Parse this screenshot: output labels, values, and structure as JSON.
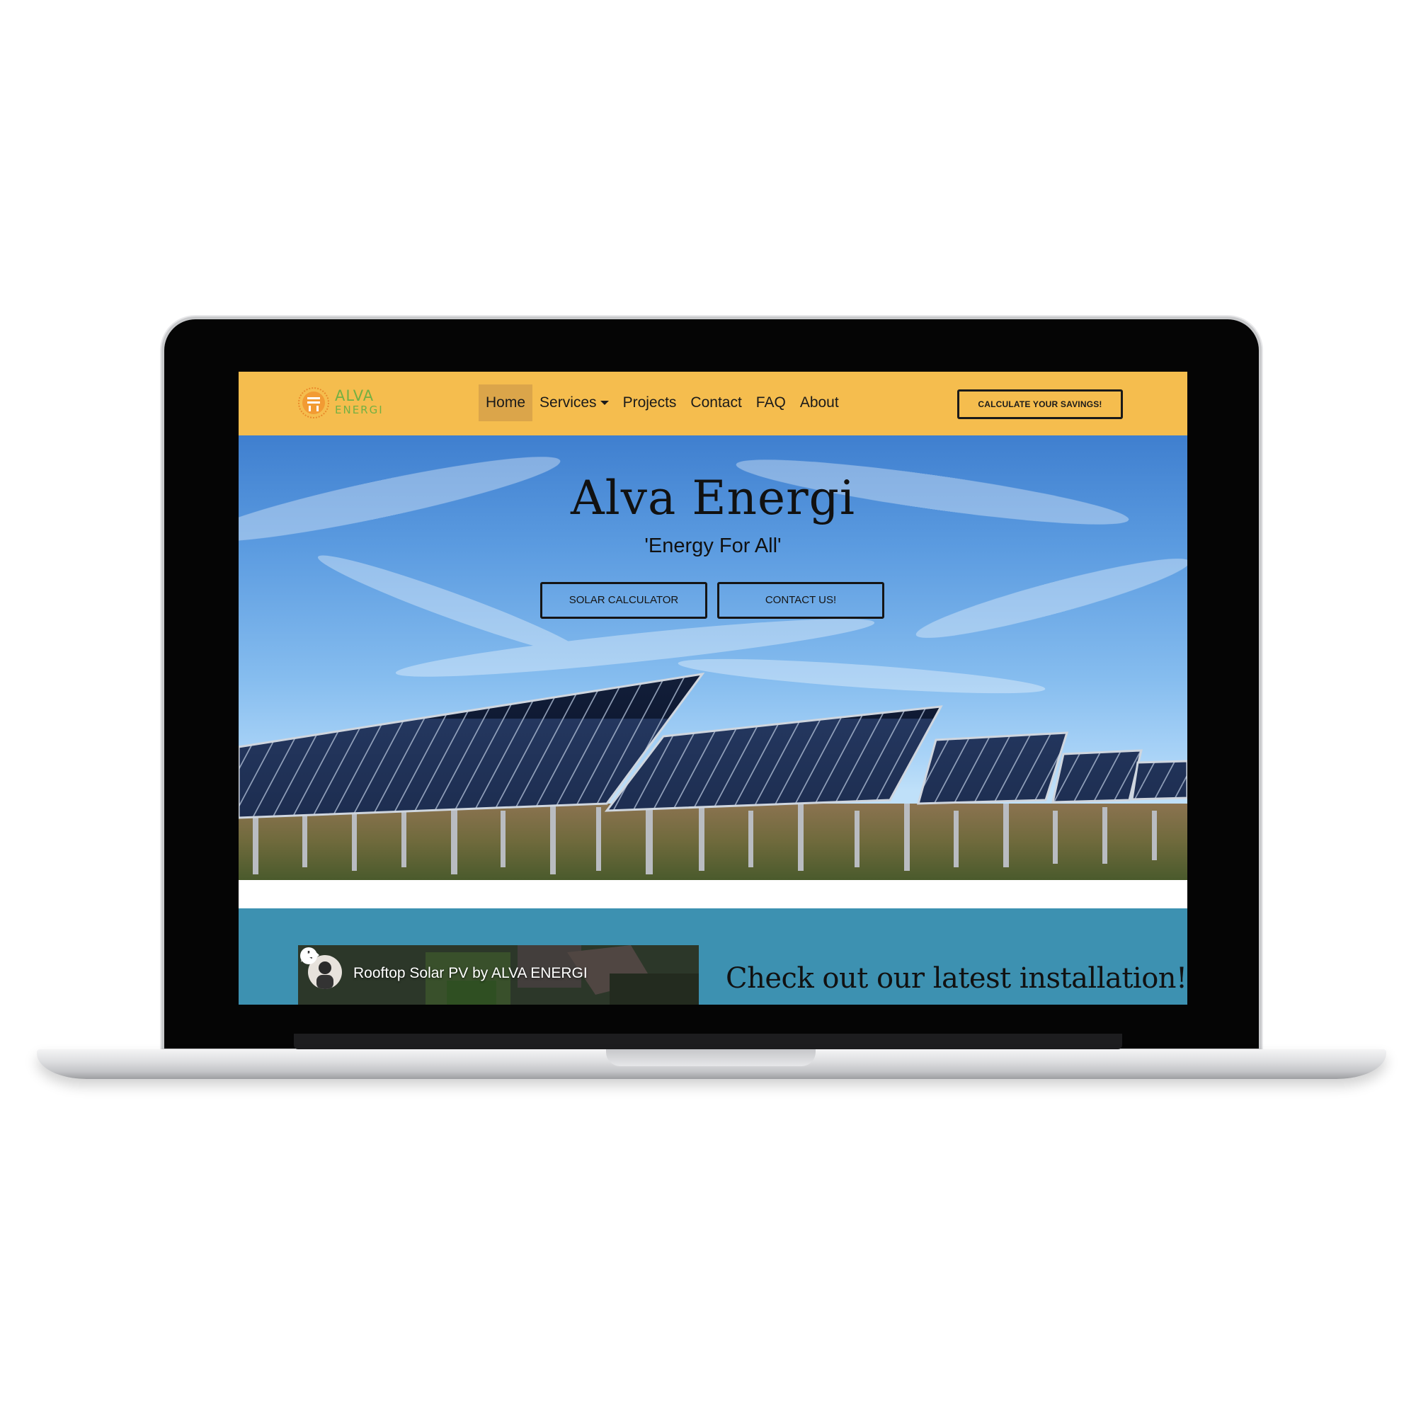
{
  "navbar": {
    "brand": {
      "line1": "ALVA",
      "line2": "ENERGI"
    },
    "links": [
      {
        "label": "Home",
        "active": true
      },
      {
        "label": "Services",
        "dropdown": true
      },
      {
        "label": "Projects"
      },
      {
        "label": "Contact"
      },
      {
        "label": "FAQ"
      },
      {
        "label": "About"
      }
    ],
    "cta_label": "CALCULATE YOUR SAVINGS!",
    "background": "#f5bd4e",
    "brand_color": "#73b043"
  },
  "hero": {
    "title": "Alva Energi",
    "subtitle": "'Energy For All'",
    "buttons": [
      {
        "label": "SOLAR CALCULATOR"
      },
      {
        "label": "CONTACT US!"
      }
    ]
  },
  "feature": {
    "video_title": "Rooftop Solar PV by ALVA ENERGI",
    "heading": "Check out our latest installation!",
    "background": "#3d91b1",
    "icons": [
      "clock-icon",
      "share-icon"
    ]
  }
}
